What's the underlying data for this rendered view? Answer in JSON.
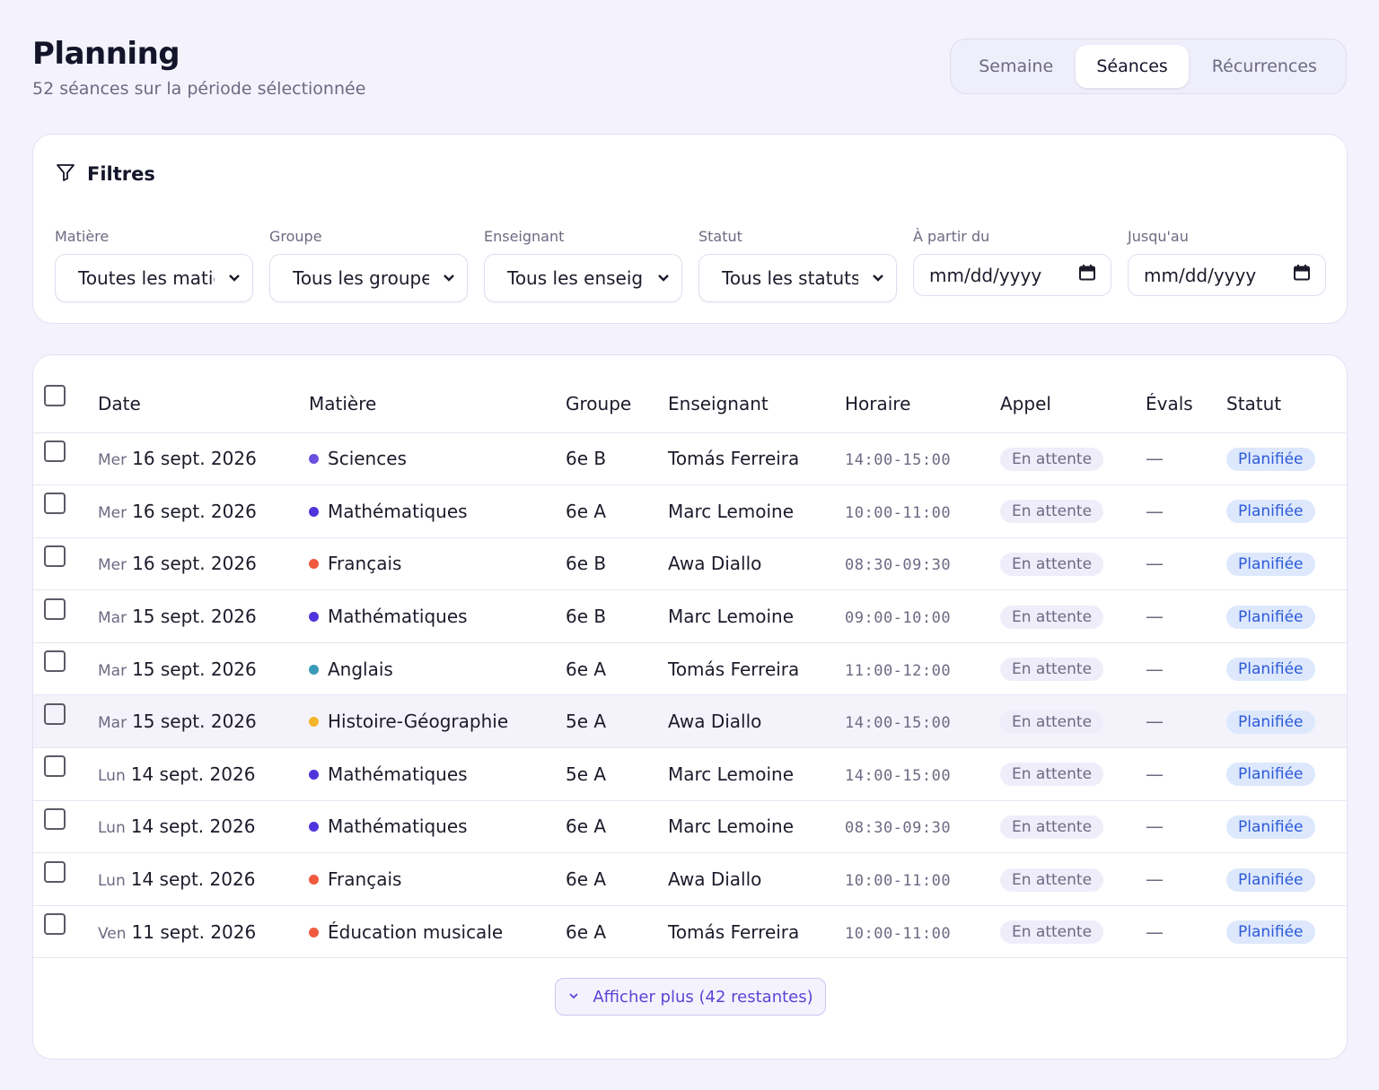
{
  "header": {
    "title": "Planning",
    "subtitle": "52 séances sur la période sélectionnée"
  },
  "view_tabs": [
    {
      "label": "Semaine",
      "active": false
    },
    {
      "label": "Séances",
      "active": true
    },
    {
      "label": "Récurrences",
      "active": false
    }
  ],
  "filters": {
    "title": "Filtres",
    "matiere": {
      "label": "Matière",
      "value": "Toutes les matières"
    },
    "groupe": {
      "label": "Groupe",
      "value": "Tous les groupes"
    },
    "enseignant": {
      "label": "Enseignant",
      "value": "Tous les enseignants"
    },
    "statut": {
      "label": "Statut",
      "value": "Tous les statuts"
    },
    "from": {
      "label": "À partir du",
      "placeholder": "mm/dd/yyyy"
    },
    "to": {
      "label": "Jusqu'au",
      "placeholder": "mm/dd/yyyy"
    }
  },
  "table": {
    "columns": {
      "date": "Date",
      "matiere": "Matière",
      "groupe": "Groupe",
      "enseignant": "Enseignant",
      "horaire": "Horaire",
      "appel": "Appel",
      "evals": "Évals",
      "statut": "Statut"
    },
    "rows": [
      {
        "day": "Mer",
        "date": "16 sept. 2026",
        "subject": "Sciences",
        "subject_color": "#6a4fe0",
        "group": "6e B",
        "teacher": "Tomás Ferreira",
        "time": "14:00-15:00",
        "appel": "En attente",
        "evals": "—",
        "status": "Planifiée",
        "highlighted": false
      },
      {
        "day": "Mer",
        "date": "16 sept. 2026",
        "subject": "Mathématiques",
        "subject_color": "#5234dc",
        "group": "6e A",
        "teacher": "Marc Lemoine",
        "time": "10:00-11:00",
        "appel": "En attente",
        "evals": "—",
        "status": "Planifiée",
        "highlighted": false
      },
      {
        "day": "Mer",
        "date": "16 sept. 2026",
        "subject": "Français",
        "subject_color": "#f0593e",
        "group": "6e B",
        "teacher": "Awa Diallo",
        "time": "08:30-09:30",
        "appel": "En attente",
        "evals": "—",
        "status": "Planifiée",
        "highlighted": false
      },
      {
        "day": "Mar",
        "date": "15 sept. 2026",
        "subject": "Mathématiques",
        "subject_color": "#5234dc",
        "group": "6e B",
        "teacher": "Marc Lemoine",
        "time": "09:00-10:00",
        "appel": "En attente",
        "evals": "—",
        "status": "Planifiée",
        "highlighted": false
      },
      {
        "day": "Mar",
        "date": "15 sept. 2026",
        "subject": "Anglais",
        "subject_color": "#3a9bb8",
        "group": "6e A",
        "teacher": "Tomás Ferreira",
        "time": "11:00-12:00",
        "appel": "En attente",
        "evals": "—",
        "status": "Planifiée",
        "highlighted": false
      },
      {
        "day": "Mar",
        "date": "15 sept. 2026",
        "subject": "Histoire-Géographie",
        "subject_color": "#f5b52b",
        "group": "5e A",
        "teacher": "Awa Diallo",
        "time": "14:00-15:00",
        "appel": "En attente",
        "evals": "—",
        "status": "Planifiée",
        "highlighted": true
      },
      {
        "day": "Lun",
        "date": "14 sept. 2026",
        "subject": "Mathématiques",
        "subject_color": "#5234dc",
        "group": "5e A",
        "teacher": "Marc Lemoine",
        "time": "14:00-15:00",
        "appel": "En attente",
        "evals": "—",
        "status": "Planifiée",
        "highlighted": false
      },
      {
        "day": "Lun",
        "date": "14 sept. 2026",
        "subject": "Mathématiques",
        "subject_color": "#5234dc",
        "group": "6e A",
        "teacher": "Marc Lemoine",
        "time": "08:30-09:30",
        "appel": "En attente",
        "evals": "—",
        "status": "Planifiée",
        "highlighted": false
      },
      {
        "day": "Lun",
        "date": "14 sept. 2026",
        "subject": "Français",
        "subject_color": "#f0593e",
        "group": "6e A",
        "teacher": "Awa Diallo",
        "time": "10:00-11:00",
        "appel": "En attente",
        "evals": "—",
        "status": "Planifiée",
        "highlighted": false
      },
      {
        "day": "Ven",
        "date": "11 sept. 2026",
        "subject": "Éducation musicale",
        "subject_color": "#f0593e",
        "group": "6e A",
        "teacher": "Tomás Ferreira",
        "time": "10:00-11:00",
        "appel": "En attente",
        "evals": "—",
        "status": "Planifiée",
        "highlighted": false
      }
    ]
  },
  "show_more": {
    "label": "Afficher plus (42 restantes)"
  }
}
